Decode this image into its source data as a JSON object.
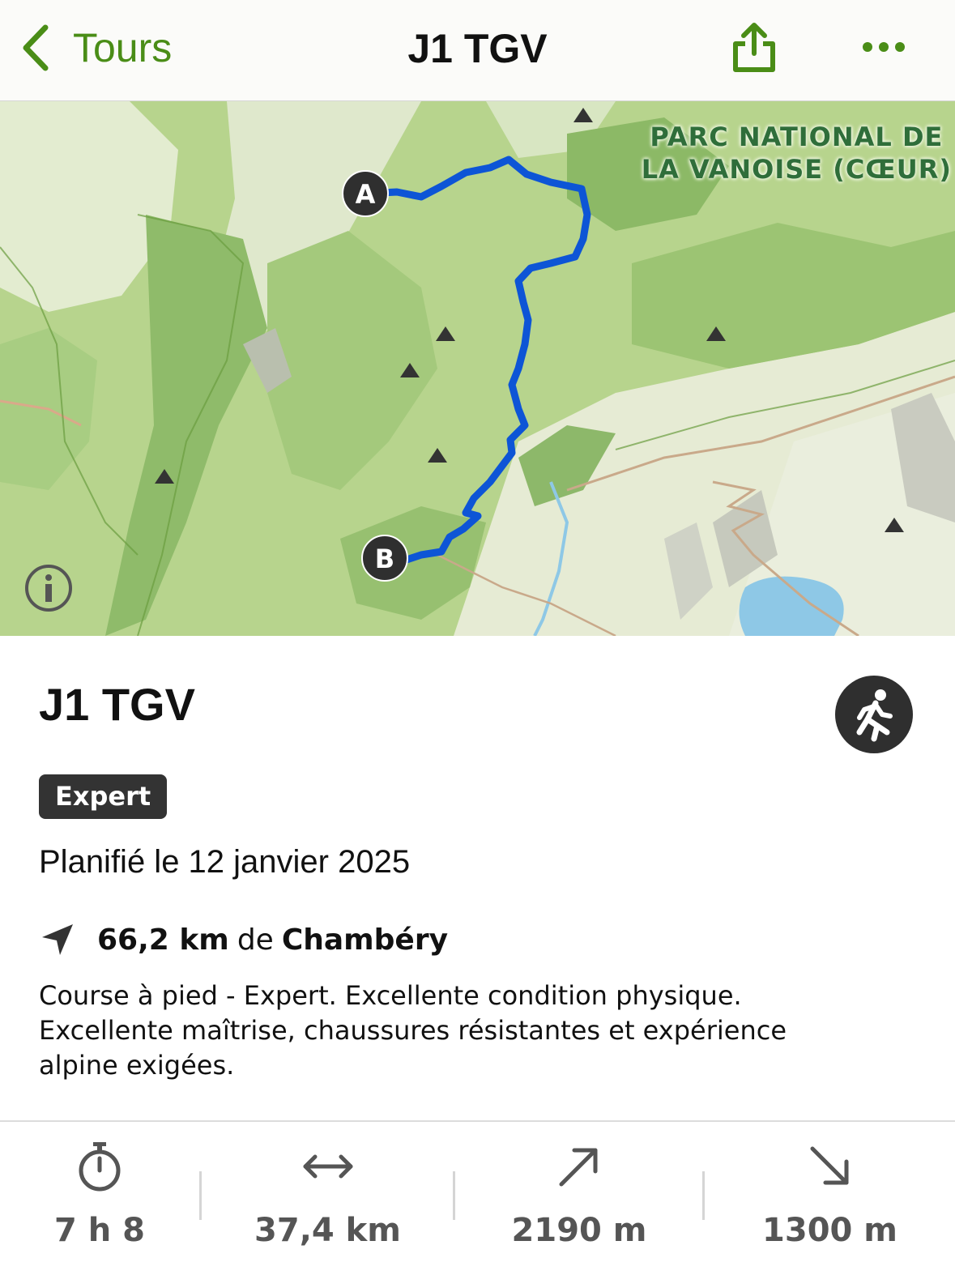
{
  "nav": {
    "back_label": "Tours",
    "title": "J1 TGV",
    "icons": {
      "back": "chevron-left-icon",
      "share": "share-icon",
      "more": "more-icon"
    },
    "accent_color": "#4a8d17"
  },
  "map": {
    "park_label_line1": "PARC NATIONAL DE",
    "park_label_line2": "LA VANOISE (CŒUR)",
    "start_marker": "A",
    "end_marker": "B",
    "route_color": "#0d55d6",
    "info_icon": "info-icon"
  },
  "tour": {
    "title": "J1 TGV",
    "sport_icon": "running-icon",
    "difficulty": "Expert",
    "planned": "Planifié le 12 janvier 2025",
    "distance_value": "66,2 km",
    "distance_connector": "de",
    "distance_city": "Chambéry",
    "description": "Course à pied - Expert. Excellente condition physique. Excellente maîtrise, chaussures résistantes et expérience alpine exigées."
  },
  "stats": [
    {
      "icon": "stopwatch-icon",
      "value": "7 h 8"
    },
    {
      "icon": "distance-arrows-icon",
      "value": "37,4 km"
    },
    {
      "icon": "uphill-arrow-icon",
      "value": "2190 m"
    },
    {
      "icon": "downhill-arrow-icon",
      "value": "1300 m"
    }
  ]
}
